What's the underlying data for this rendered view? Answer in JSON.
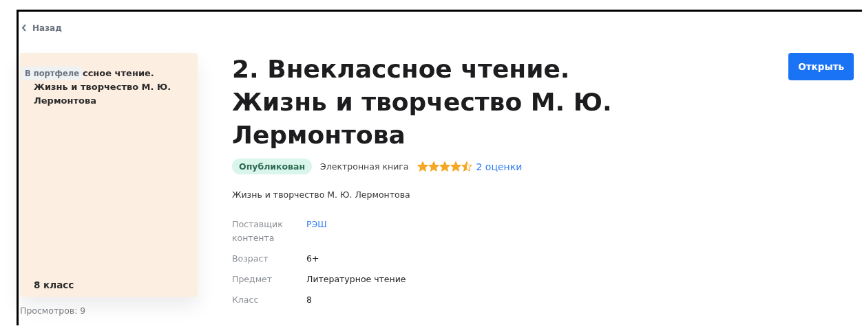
{
  "back_link": {
    "label": "Назад"
  },
  "cover": {
    "badge": "В портфеле",
    "title_first_line": "ссное чтение.",
    "title_rest": "Жизнь и творчество М. Ю. Лермонтова",
    "grade": "8 класс"
  },
  "views": "Просмотров: 9",
  "title": "2. Внеклассное чтение. Жизнь и творчество М. Ю. Лермонтова",
  "status": "Опубликован",
  "type": "Электронная книга",
  "rating": {
    "stars": 4.5,
    "count": "2 оценки"
  },
  "description": "Жизнь и творчество М. Ю. Лермонтова",
  "details": [
    {
      "label": "Поставщик контента",
      "value": "РЭШ",
      "kind": "link"
    },
    {
      "label": "Возраст",
      "value": "6+",
      "kind": "text"
    },
    {
      "label": "Предмет",
      "value": "Литературное чтение",
      "kind": "text"
    },
    {
      "label": "Класс",
      "value": "8",
      "kind": "text"
    }
  ],
  "open_button": "Открыть"
}
